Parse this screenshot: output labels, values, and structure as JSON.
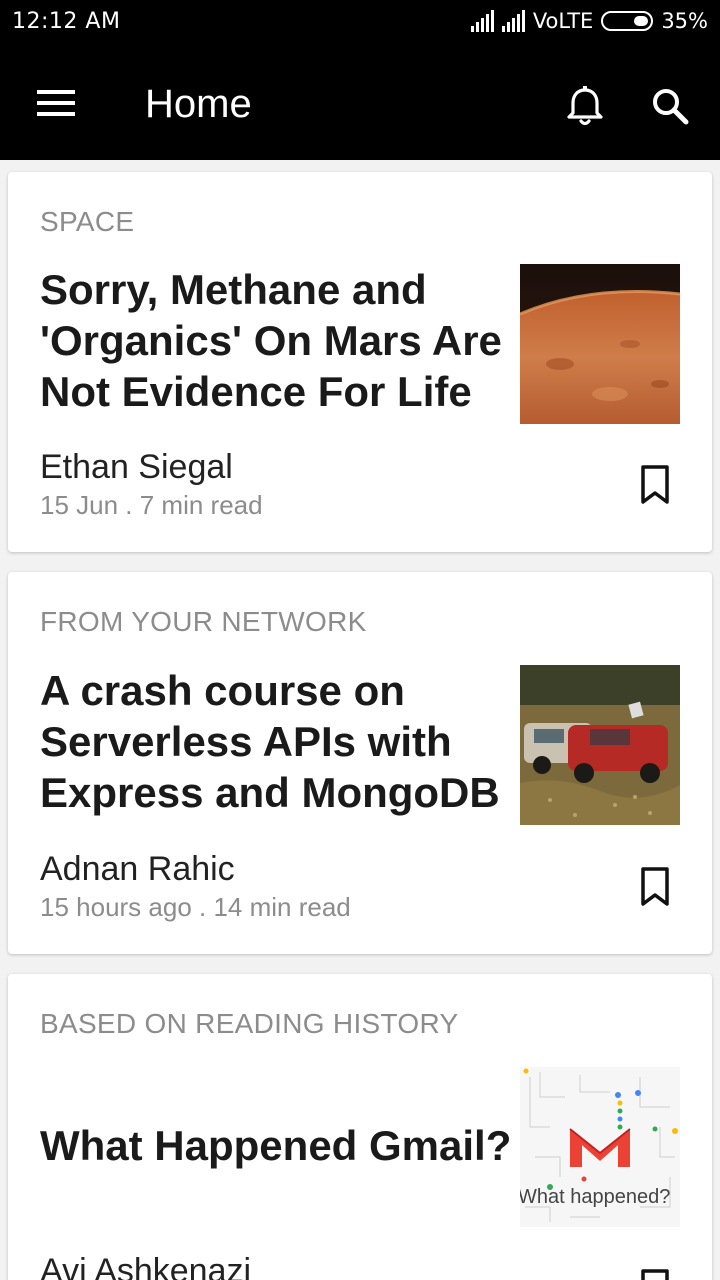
{
  "status_bar": {
    "time": "12:12 AM",
    "network": "VoLTE",
    "battery": "35%"
  },
  "app_bar": {
    "title": "Home",
    "icons": [
      "menu-icon",
      "bell-icon",
      "search-icon"
    ]
  },
  "articles": [
    {
      "category": "SPACE",
      "title": "Sorry, Methane and 'Organics' On Mars Are Not Evidence For Life",
      "author": "Ethan Siegal",
      "meta": "15 Jun . 7 min read"
    },
    {
      "category": "FROM YOUR NETWORK",
      "title": "A crash course on Serverless APIs with Express and MongoDB",
      "author": "Adnan Rahic",
      "meta": "15 hours ago . 14 min read"
    },
    {
      "category": "BASED ON READING HISTORY",
      "title": "What Happened Gmail?",
      "author": "Avi Ashkenazi",
      "thumbnail_text": "What happened?"
    }
  ]
}
